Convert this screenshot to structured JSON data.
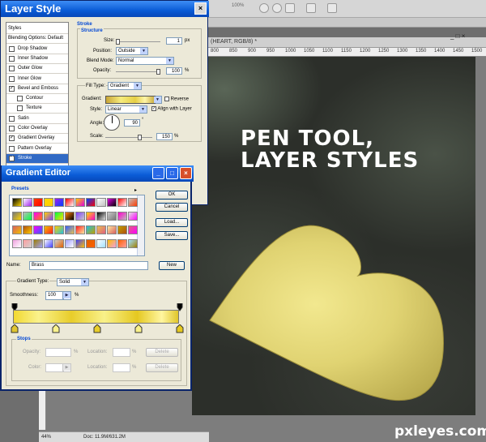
{
  "app": {
    "zoom_toolbar": "100%",
    "document_title": "(HEART, RGB/8) *",
    "ruler_ticks": [
      "800",
      "850",
      "900",
      "950",
      "1000",
      "1050",
      "1100",
      "1150",
      "1200",
      "1250",
      "1300",
      "1350",
      "1400",
      "1450",
      "1500"
    ],
    "status_zoom": "44%",
    "status_doc": "Doc: 11.9M/631.2M",
    "win_controls": "_ □ ×"
  },
  "canvas": {
    "headline": "PEN TOOL,\nLAYER STYLES",
    "watermark": "pxleyes.com",
    "heart_color": "#e0d372"
  },
  "layer_style": {
    "title": "Layer Style",
    "close": "×",
    "styles_list": [
      {
        "label": "Styles",
        "checkbox": false,
        "checked": false,
        "indent": "none"
      },
      {
        "label": "Blending Options: Default",
        "checkbox": false,
        "checked": false,
        "indent": "none"
      },
      {
        "label": "Drop Shadow",
        "checkbox": true,
        "checked": false,
        "indent": "top"
      },
      {
        "label": "Inner Shadow",
        "checkbox": true,
        "checked": false,
        "indent": "top"
      },
      {
        "label": "Outer Glow",
        "checkbox": true,
        "checked": false,
        "indent": "top"
      },
      {
        "label": "Inner Glow",
        "checkbox": true,
        "checked": false,
        "indent": "top"
      },
      {
        "label": "Bevel and Emboss",
        "checkbox": true,
        "checked": true,
        "indent": "top"
      },
      {
        "label": "Contour",
        "checkbox": true,
        "checked": false,
        "indent": "sub"
      },
      {
        "label": "Texture",
        "checkbox": true,
        "checked": false,
        "indent": "sub"
      },
      {
        "label": "Satin",
        "checkbox": true,
        "checked": false,
        "indent": "top"
      },
      {
        "label": "Color Overlay",
        "checkbox": true,
        "checked": false,
        "indent": "top"
      },
      {
        "label": "Gradient Overlay",
        "checkbox": true,
        "checked": true,
        "indent": "top"
      },
      {
        "label": "Pattern Overlay",
        "checkbox": true,
        "checked": false,
        "indent": "top"
      },
      {
        "label": "Stroke",
        "checkbox": true,
        "checked": true,
        "indent": "top",
        "selected": true
      }
    ],
    "stroke": {
      "section": "Stroke",
      "structure": "Structure",
      "size_label": "Size:",
      "size_value": "1",
      "size_unit": "px",
      "position_label": "Position:",
      "position_value": "Outside",
      "blend_label": "Blend Mode:",
      "blend_value": "Normal",
      "opacity_label": "Opacity:",
      "opacity_value": "100",
      "opacity_unit": "%",
      "filltype_label": "Fill Type:",
      "filltype_value": "Gradient",
      "gradient_label": "Gradient:",
      "reverse_label": "Reverse",
      "style_label": "Style:",
      "style_value": "Linear",
      "align_label": "Align with Layer",
      "angle_label": "Angle:",
      "angle_value": "90",
      "angle_unit": "°",
      "scale_label": "Scale:",
      "scale_value": "150",
      "scale_unit": "%"
    }
  },
  "gradient_editor": {
    "title": "Gradient Editor",
    "btn_min": "_",
    "btn_max": "□",
    "btn_close": "×",
    "presets_label": "Presets",
    "presets_menu": "▸",
    "ok": "OK",
    "cancel": "Cancel",
    "load": "Load...",
    "save": "Save...",
    "name_label": "Name:",
    "name_value": "Brass",
    "new_button": "New",
    "gradient_type_label": "Gradient Type:",
    "gradient_type_value": "Solid",
    "smoothness_label": "Smoothness:",
    "smoothness_value": "100",
    "smoothness_unit": "%",
    "stops_label": "Stops",
    "opacity_label": "Opacity:",
    "opacity_unit": "%",
    "color_label": "Color:",
    "location_label": "Location:",
    "location_unit": "%",
    "delete": "Delete",
    "preset_colors": [
      [
        "#000000",
        "#ffffff",
        "#ff3b00",
        "#ffd800",
        "#a020f0",
        "#ff0000",
        "#ffcc00",
        "#0040ff",
        "#ffffff",
        "#e000e0",
        "#ff0000",
        "#c0c0c0"
      ],
      [
        "#777777",
        "#bbbbbb",
        "#ff00ff",
        "#ffd400",
        "#00ff40",
        "#ff8000",
        "#8040ff",
        "#ffdd00",
        "#000000",
        "#c8c8c8",
        "#ff00cc",
        "#e0e0e0"
      ],
      [
        "#d86060",
        "#b05010",
        "#ff00ff",
        "#f0c000",
        "#ffcc00",
        "#3060ff",
        "#ff2020",
        "#20c0e0",
        "#e8c050",
        "#ffe8a0",
        "#c0a000",
        "#e06080"
      ],
      [
        "#f0a0e0",
        "#ff9f9f",
        "#9f7f00",
        "#ffffff",
        "#d0d0d0",
        "#a0a0ff",
        "#4040ff",
        "#e06000",
        "#ffffff",
        "#ffbf00",
        "#ff6000",
        "#a0e0ff"
      ]
    ]
  }
}
